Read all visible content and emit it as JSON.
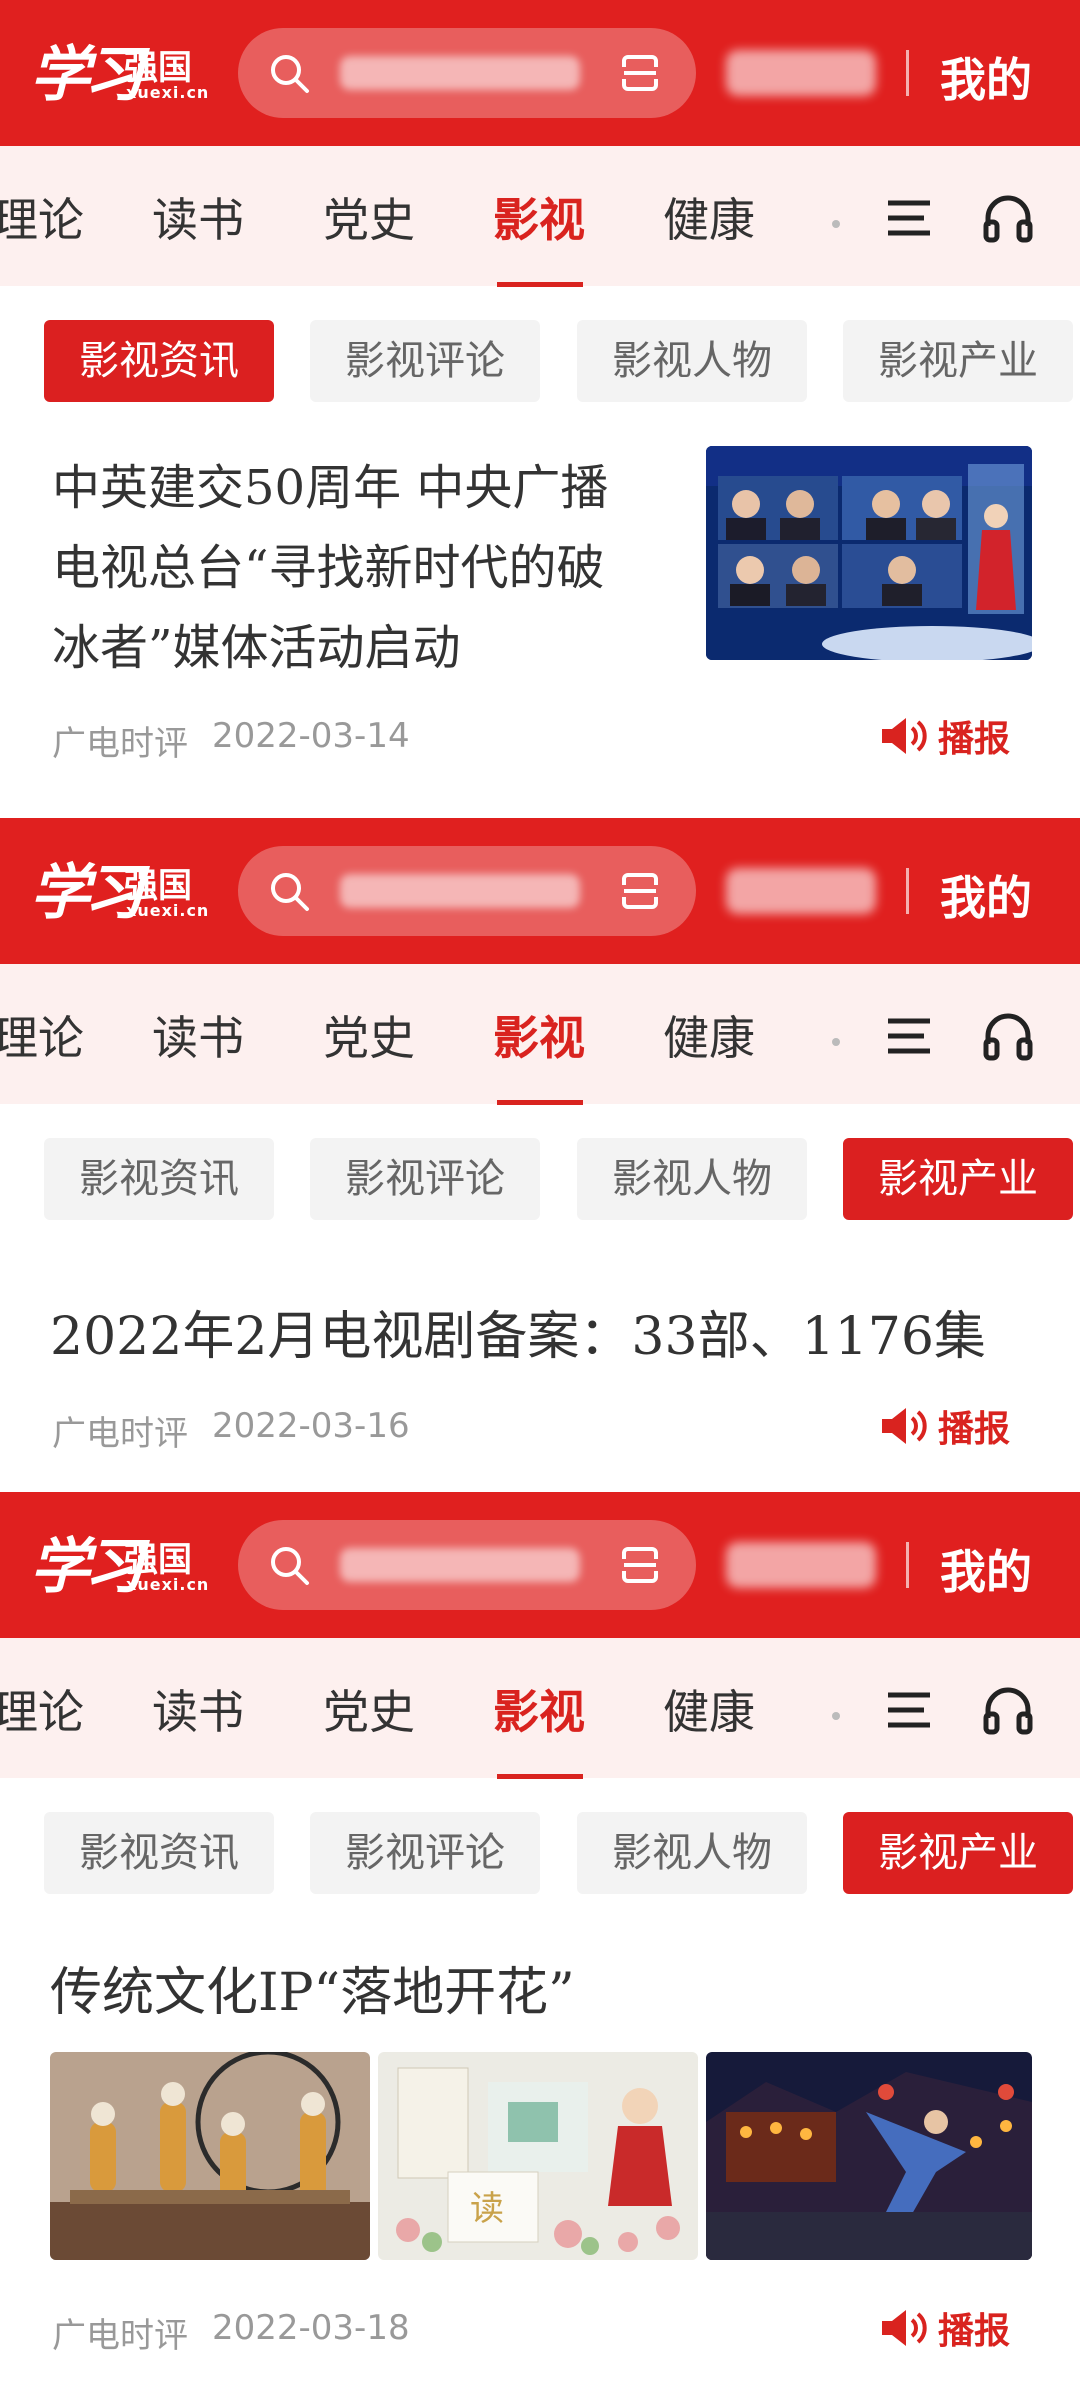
{
  "header": {
    "logo_text": "学习",
    "logo_brand": "强国",
    "logo_domain": "xuexi.cn",
    "account_label": "我的",
    "search_icon": "search-icon",
    "scan_icon": "scan-icon"
  },
  "nav": {
    "tabs": [
      "理论",
      "读书",
      "党史",
      "影视",
      "健康"
    ],
    "active": "影视",
    "menu_icon": "menu-icon",
    "audio_icon": "headset-icon"
  },
  "subnav": [
    "影视资讯",
    "影视评论",
    "影视人物",
    "影视产业"
  ],
  "panels": [
    {
      "active_chip": "影视资讯",
      "article": {
        "title_lines": [
          "中英建交50周年 中央广播",
          "电视总台“寻找新时代的破",
          "冰者”媒体活动启动"
        ],
        "source": "广电时评",
        "date": "2022-03-14",
        "broadcast_label": "播报"
      }
    },
    {
      "active_chip": "影视产业",
      "article": {
        "title_lines": [
          "2022年2月电视剧备案：33部、1176集"
        ],
        "source": "广电时评",
        "date": "2022-03-16",
        "broadcast_label": "播报"
      }
    },
    {
      "active_chip": "影视产业",
      "article": {
        "title_lines": [
          "传统文化IP“落地开花”"
        ],
        "source": "广电时评",
        "date": "2022-03-18",
        "broadcast_label": "播报"
      }
    }
  ],
  "colors": {
    "brand_red": "#e0201f",
    "active_red": "#d9231f",
    "nav_bg": "#fdf0ef",
    "chip_bg": "#f3f3f3",
    "meta_gray": "#999999"
  }
}
